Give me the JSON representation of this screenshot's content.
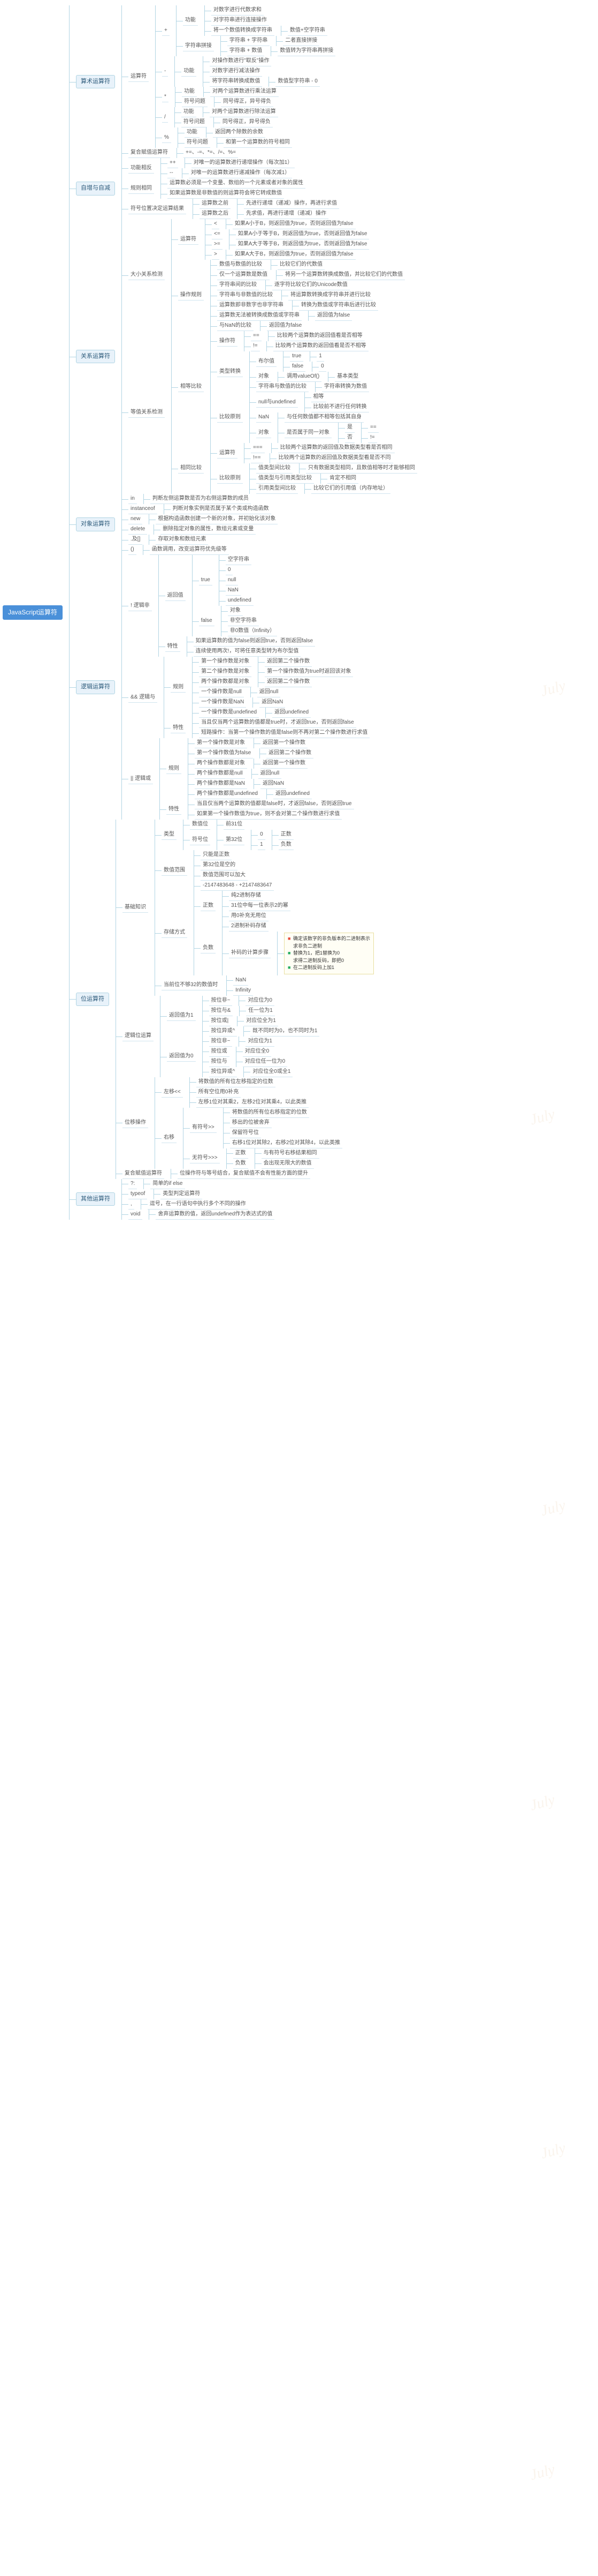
{
  "root": "JavaScript运算符",
  "watermark": "July",
  "arith": {
    "title": "算术运算符",
    "op": "运算符",
    "plus": "+",
    "plus_fn": "功能",
    "plus_f1": "对数字进行代数求和",
    "plus_f2": "对字符串进行连接操作",
    "plus_f3": "将一个数值转换成字符串",
    "plus_f3a": "数值+空字符串",
    "concat": "字符串拼接",
    "concat1": "字符串 + 字符串",
    "concat1v": "二者直接拼接",
    "concat2": "字符串 + 数值",
    "concat2v": "数值转为字符串再拼接",
    "minus": "-",
    "minus_fn": "功能",
    "minus_f1": "对操作数进行\"取反\"操作",
    "minus_f2": "对数字进行减法操作",
    "minus_f3": "将字符串转换成数值",
    "minus_f3v": "数值型字符串 - 0",
    "mul": "*",
    "mul_fn": "功能",
    "mul_f1": "对两个运算数进行乘法运算",
    "mul_sign": "符号问题",
    "mul_s1": "同号得正，异号得负",
    "div": "/",
    "div_fn": "功能",
    "div_f1": "对两个运算数进行除法运算",
    "div_sign": "符号问题",
    "div_s1": "同号得正，异号得负",
    "mod": "%",
    "mod_fn": "功能",
    "mod_f1": "返回两个除数的余数",
    "mod_sign": "符号问题",
    "mod_s1": "和第一个运算数的符号相同",
    "compound": "复合赋值运算符",
    "compound_v": "+=、-=、*=、/=、%="
  },
  "incdec": {
    "title": "自增与自减",
    "seg": "功能相反",
    "seg1": "++",
    "seg1v": "对唯一的运算数进行递增操作（每次加1）",
    "seg2": "--",
    "seg2v": "对唯一的运算数进行递减操作（每次减1）",
    "rule": "规则相同",
    "rule1": "运算数必须是一个变量、数组的一个元素或者对象的属性",
    "rule2": "如果运算数是非数值的则运算符会将它转成数值",
    "pos": "符号位置决定运算结果",
    "pos1": "运算数之前",
    "pos1v": "先进行递增（递减）操作，再进行求值",
    "pos2": "运算数之后",
    "pos2v": "先求值，再进行递增（递减）操作"
  },
  "rel": {
    "title": "关系运算符",
    "size": "大小关系检测",
    "op": "运算符",
    "lt": "<",
    "ltv": "如果A小于B，则返回值为true，否则返回值为false",
    "le": "<=",
    "lev": "如果A小于等于B，则返回值为true，否则返回值为false",
    "ge": ">=",
    "gev": "如果A大于等于B，则返回值为true，否则返回值为false",
    "gt": ">",
    "gtv": "如果A大于B，则返回值为true，否则返回值为false",
    "rules": "操作规则",
    "r1": "数值与数值的比较",
    "r1v": "比较它们的代数值",
    "r2": "仅一个运算数是数值",
    "r2v": "将另一个运算数转换成数值，并比较它们的代数值",
    "r3": "字符串间的比较",
    "r3v": "逐字符比较它们的Unicode数值",
    "r4": "字符串与非数值的比较",
    "r4v": "将运算数转换成字符串并进行比较",
    "r5": "运算数即非数字也非字符串",
    "r5v": "转换为数值或字符串后进行比较",
    "r6": "运算数无法被转换成数值或字符串",
    "r6v": "返回值为false",
    "r7": "与NaN的比较",
    "r7v": "返回值为false",
    "eq": "等值关系检测",
    "eqop": "相等比较",
    "eqop_op": "操作符",
    "eq1": "==",
    "eq1v": "比较两个运算数的返回值看是否相等",
    "eq2": "!=",
    "eq2v": "比较两个运算数的返回值看是否不相等",
    "eqtype": "类型转换",
    "bool": "布尔值",
    "bool_t": "true",
    "bool_tv": "1",
    "bool_f": "false",
    "bool_fv": "0",
    "obj": "对象",
    "objv": "调用valueOf()",
    "objv2": "基本类型",
    "str": "字符串与数值的比较",
    "strv": "字符串转换为数值",
    "eqrule": "比较原则",
    "er1": "null与undefined",
    "er1a": "相等",
    "er1b": "比较前不进行任何转换",
    "er2": "NaN",
    "er2a": "与任何数值都不相等包括其自身",
    "er3": "对象",
    "er3a": "是否属于同一对象",
    "er3a1": "是",
    "er3a1v": "==",
    "er3a2": "否",
    "er3a2v": "!=",
    "same": "相同比较",
    "same_op": "运算符",
    "s1": "===",
    "s1v": "比较两个运算数的返回值及数据类型看是否相同",
    "s2": "!==",
    "s2v": "比较两个运算数的返回值及数据类型看是否不同",
    "srule": "比较原则",
    "sr1": "值类型间比较",
    "sr1v": "只有数据类型相同，且数值相等时才能够相同",
    "sr2": "值类型与引用类型比较",
    "sr2v": "肯定不相同",
    "sr3": "引用类型间比较",
    "sr3v": "比较它们的引用值（内存地址）"
  },
  "obj": {
    "title": "对象运算符",
    "in": "in",
    "inv": "判断左侧运算数是否为右侧运算数的成员",
    "iof": "instanceof",
    "iofv": "判断对象实例是否属于某个类或构造函数",
    "new": "new",
    "newv": "根据构造函数创建一个新的对象，并初始化该对象",
    "del": "delete",
    "delv": "删除指定对象的属性，数组元素或变量",
    "dot": ".及[]",
    "dotv": "存取对象和数组元素",
    "fn": "()",
    "fnv": "函数调用，改变运算符优先级等"
  },
  "logic": {
    "title": "逻辑运算符",
    "not": "! 逻辑非",
    "not_ret": "返回值",
    "not_t": "true",
    "not_t1": "空字符串",
    "not_t2": "0",
    "not_t3": "null",
    "not_t4": "NaN",
    "not_t5": "undefined",
    "not_f": "false",
    "not_f1": "对象",
    "not_f2": "非空字符串",
    "not_f3": "非0数值（Infinity）",
    "not_sp": "特性",
    "not_sp1": "如果运算数的值为false则返回true，否则返回false",
    "not_sp2": "连续使用两次!，可将任意类型转为布尔型值",
    "and": "&& 逻辑与",
    "and_rule": "规则",
    "a1": "第一个操作数是对象",
    "a1v": "返回第二个操作数",
    "a2": "第二个操作数是对象",
    "a2v": "第一个操作数值为true时返回该对象",
    "a3": "两个操作数都是对象",
    "a3v": "返回第二个操作数",
    "a4": "一个操作数是null",
    "a4v": "返回null",
    "a5": "一个操作数是NaN",
    "a5v": "返回NaN",
    "a6": "一个操作数是undefined",
    "a6v": "返回undefined",
    "and_sp": "特性",
    "and_sp1": "当且仅当两个运算数的值都是true时，才返回true，否则返回false",
    "and_sp2": "短路操作：当第一个操作数的值是false则不再对第二个操作数进行求值",
    "or": "|| 逻辑或",
    "or_rule": "规则",
    "o1": "第一个操作数是对象",
    "o1v": "返回第一个操作数",
    "o2": "第一个操作数值为false",
    "o2v": "返回第二个操作数",
    "o3": "两个操作数都是对象",
    "o3v": "返回第一个操作数",
    "o4": "两个操作数都是null",
    "o4v": "返回null",
    "o5": "两个操作数都是NaN",
    "o5v": "返回NaN",
    "o6": "两个操作数都是undefined",
    "o6v": "返回undefined",
    "or_sp": "特性",
    "or_sp1": "当且仅当两个运算数的值都是false时，才返回false，否则返回true",
    "or_sp2": "如果第一个操作数值为true，则不会对第二个操作数进行求值"
  },
  "bit": {
    "title": "位运算符",
    "basic": "基础知识",
    "type": "类型",
    "t1": "数值位",
    "t1a": "前31位",
    "t2": "符号位",
    "t2a": "第32位",
    "t2a0": "0",
    "t2a0v": "正数",
    "t2a1": "1",
    "t2a1v": "负数",
    "fmt": "数值范围",
    "fmt1": "只能是正数",
    "fmt2": "第32位是空的",
    "fmt3": "数值范围可以加大",
    "fmt4": "-2147483648 - +2147483647",
    "store": "存储方式",
    "pos": "正数",
    "pos1": "纯2进制存储",
    "pos2": "31位中每一位表示2的幂",
    "pos3": "用0补充无用位",
    "neg": "负数",
    "neg1": "2进制补码存储",
    "neg2": "补码的计算步骤",
    "note1": "确定该数字的非负版本的二进制表示",
    "note1p": "求非负二进制",
    "note2": "替换为1，把1替换为0",
    "note2p": "求得二进制反码，即把0",
    "note3": "在二进制反码上加1",
    "nan": "当前位不够32的数值时",
    "nan1": "NaN",
    "nan2": "Infinity",
    "lnot": "逻辑位运算",
    "lnot_r": "返回值为1",
    "ln1": "按位非~",
    "ln1v": "对应位为0",
    "ln2": "按位与&",
    "ln2v": "任一位为1",
    "ln3": "按位或|",
    "ln3v": "对应位全为1",
    "ln4": "按位异或^",
    "ln4v": "既不同时为0，也不同时为1",
    "lnot_r0": "返回值为0",
    "lz1": "按位非~",
    "lz1v": "对应位为1",
    "lz2": "按位或",
    "lz2v": "对应位全0",
    "lz3": "按位与",
    "lz3v": "对应位任一位为0",
    "lz4": "按位异或^",
    "lz4v": "对应位全0或全1",
    "shift": "位移操作",
    "sl": "左移<<",
    "sl1": "将数值的所有位左移指定的位数",
    "sl2": "所有空位用0补充",
    "sl3": "左移1位对其乘2，左移2位对其乘4，以此类推",
    "sr": "右移",
    "sr_s": "有符号>>",
    "sr_s1": "将数值的所有位右移指定的位数",
    "sr_s2": "移出的位被舍弃",
    "sr_s3": "保留符号位",
    "sr_s4": "右移1位对其除2，右移2位对其除4，以此类推",
    "sr_u": "无符号>>>",
    "sr_u1": "正数",
    "sr_u1v": "与有符号右移结果相同",
    "sr_u2": "负数",
    "sr_u2v": "会出现无限大的数值",
    "cbit": "复合赋值运算符",
    "cbit1": "位操作符与等号结合，复合赋值不会有性能方面的提升"
  },
  "other": {
    "title": "其他运算符",
    "tern": "?:",
    "ternv": "简单的if else",
    "typeof": "typeof",
    "typeofv": "类型判定运算符",
    "comma": ",",
    "commav": "逗号，在一行语句中执行多个不同的操作",
    "void": "void",
    "voidv": "舍弃运算数的值，返回undefined作为表达式的值"
  }
}
